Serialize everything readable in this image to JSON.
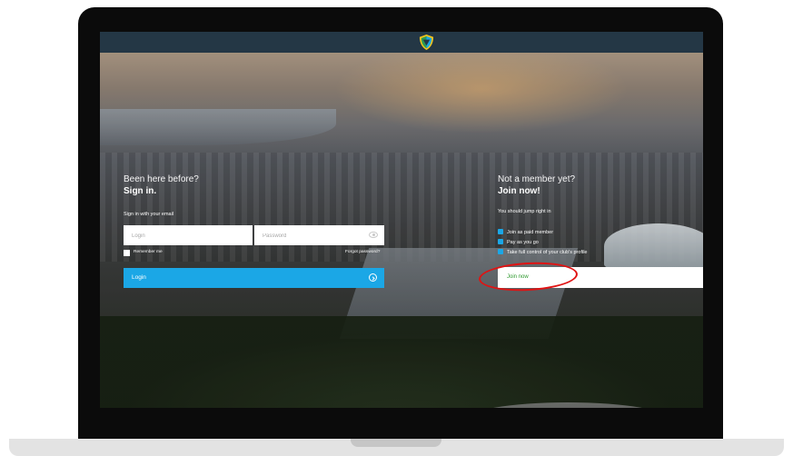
{
  "header": {
    "logo_icon": "shield-logo-icon"
  },
  "signin": {
    "question": "Been here before?",
    "heading": "Sign in.",
    "email_prompt": "Sign in with your email",
    "login_placeholder": "Login",
    "password_placeholder": "Password",
    "remember_label": "Remember me",
    "forgot_label": "Forgot password?",
    "login_button": "Login"
  },
  "join": {
    "question": "Not a member yet?",
    "heading": "Join now!",
    "subtitle": "You should jump right in",
    "benefits": [
      "Join as paid member",
      "Pay as you go",
      "Take full control of your club's profile"
    ],
    "join_button": "Join now"
  },
  "colors": {
    "accent": "#1ba7e6",
    "topbar": "#243745",
    "highlight": "#e01313",
    "join_text": "#2f9a2f"
  }
}
